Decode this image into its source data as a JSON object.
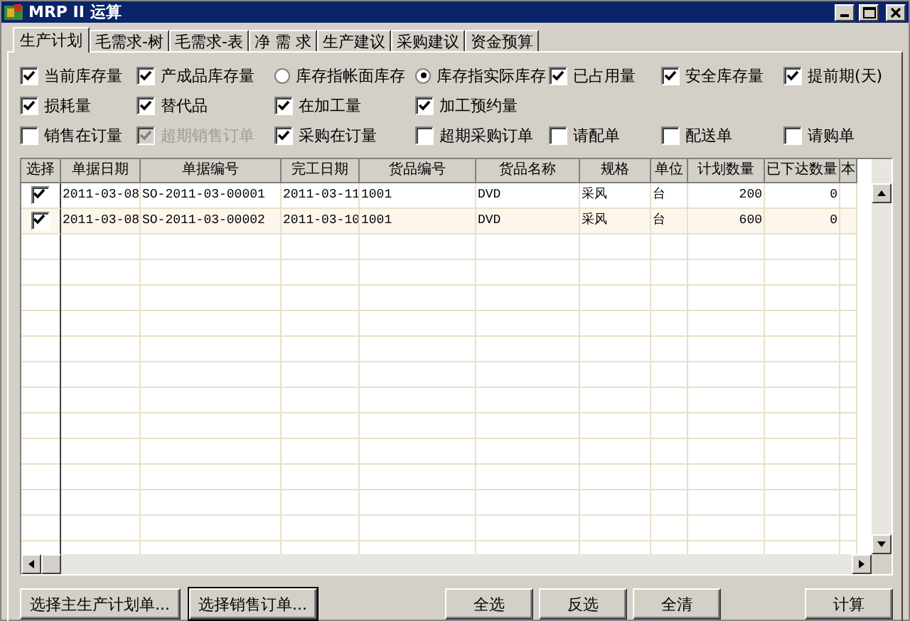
{
  "window": {
    "title": "MRP II 运算"
  },
  "tabs": [
    {
      "label": "生产计划",
      "selected": true
    },
    {
      "label": "毛需求-树",
      "selected": false
    },
    {
      "label": "毛需求-表",
      "selected": false
    },
    {
      "label": "净 需 求",
      "selected": false
    },
    {
      "label": "生产建议",
      "selected": false
    },
    {
      "label": "采购建议",
      "selected": false
    },
    {
      "label": "资金预算",
      "selected": false
    }
  ],
  "option_rows": [
    [
      {
        "kind": "checkbox",
        "label": "当前库存量",
        "checked": true,
        "disabled": false
      },
      {
        "kind": "checkbox",
        "label": "产成品库存量",
        "checked": true,
        "disabled": false
      },
      {
        "kind": "radio",
        "label": "库存指帐面库存",
        "checked": false,
        "disabled": false
      },
      {
        "kind": "radio",
        "label": "库存指实际库存",
        "checked": true,
        "disabled": false
      },
      {
        "kind": "checkbox",
        "label": "已占用量",
        "checked": true,
        "disabled": false
      },
      {
        "kind": "checkbox",
        "label": "安全库存量",
        "checked": true,
        "disabled": false
      },
      {
        "kind": "checkbox",
        "label": "提前期(天)",
        "checked": true,
        "disabled": false
      }
    ],
    [
      {
        "kind": "checkbox",
        "label": "损耗量",
        "checked": true,
        "disabled": false
      },
      {
        "kind": "checkbox",
        "label": "替代品",
        "checked": true,
        "disabled": false
      },
      {
        "kind": "checkbox",
        "label": "在加工量",
        "checked": true,
        "disabled": false
      },
      {
        "kind": "checkbox",
        "label": "加工预约量",
        "checked": true,
        "disabled": false
      }
    ],
    [
      {
        "kind": "checkbox",
        "label": "销售在订量",
        "checked": false,
        "disabled": false
      },
      {
        "kind": "checkbox",
        "label": "超期销售订单",
        "checked": true,
        "disabled": true
      },
      {
        "kind": "checkbox",
        "label": "采购在订量",
        "checked": true,
        "disabled": false
      },
      {
        "kind": "checkbox",
        "label": "超期采购订单",
        "checked": false,
        "disabled": false
      },
      {
        "kind": "checkbox",
        "label": "请配单",
        "checked": false,
        "disabled": false
      },
      {
        "kind": "checkbox",
        "label": "配送单",
        "checked": false,
        "disabled": false
      },
      {
        "kind": "checkbox",
        "label": "请购单",
        "checked": false,
        "disabled": false
      }
    ]
  ],
  "table": {
    "columns": [
      "选择",
      "单据日期",
      "单据编号",
      "完工日期",
      "货品编号",
      "货品名称",
      "规格",
      "单位",
      "计划数量",
      "已下达数量",
      "本"
    ],
    "rows": [
      {
        "selected": false,
        "cells": [
          {
            "kind": "check",
            "checked": true
          },
          {
            "kind": "text",
            "text": "2011-03-08"
          },
          {
            "kind": "text",
            "text": "SO-2011-03-00001"
          },
          {
            "kind": "text",
            "text": "2011-03-11"
          },
          {
            "kind": "text",
            "text": "1001"
          },
          {
            "kind": "text",
            "text": "DVD"
          },
          {
            "kind": "text",
            "text": "采风"
          },
          {
            "kind": "text",
            "text": "台"
          },
          {
            "kind": "text",
            "text": "200"
          },
          {
            "kind": "text",
            "text": "0"
          }
        ]
      },
      {
        "selected": true,
        "cells": [
          {
            "kind": "check",
            "checked": true
          },
          {
            "kind": "text",
            "text": "2011-03-08"
          },
          {
            "kind": "text",
            "text": "SO-2011-03-00002"
          },
          {
            "kind": "text",
            "text": "2011-03-10"
          },
          {
            "kind": "text",
            "text": "1001"
          },
          {
            "kind": "text",
            "text": "DVD"
          },
          {
            "kind": "text",
            "text": "采风"
          },
          {
            "kind": "text",
            "text": "台"
          },
          {
            "kind": "text",
            "text": "600"
          },
          {
            "kind": "text",
            "text": "0"
          }
        ]
      }
    ]
  },
  "buttons": [
    {
      "label": "选择主生产计划单...",
      "focused": false
    },
    {
      "label": "选择销售订单...",
      "focused": true
    },
    {
      "label": "全选",
      "focused": false
    },
    {
      "label": "反选",
      "focused": false
    },
    {
      "label": "全清",
      "focused": false
    },
    {
      "label": "计算",
      "focused": false
    }
  ]
}
